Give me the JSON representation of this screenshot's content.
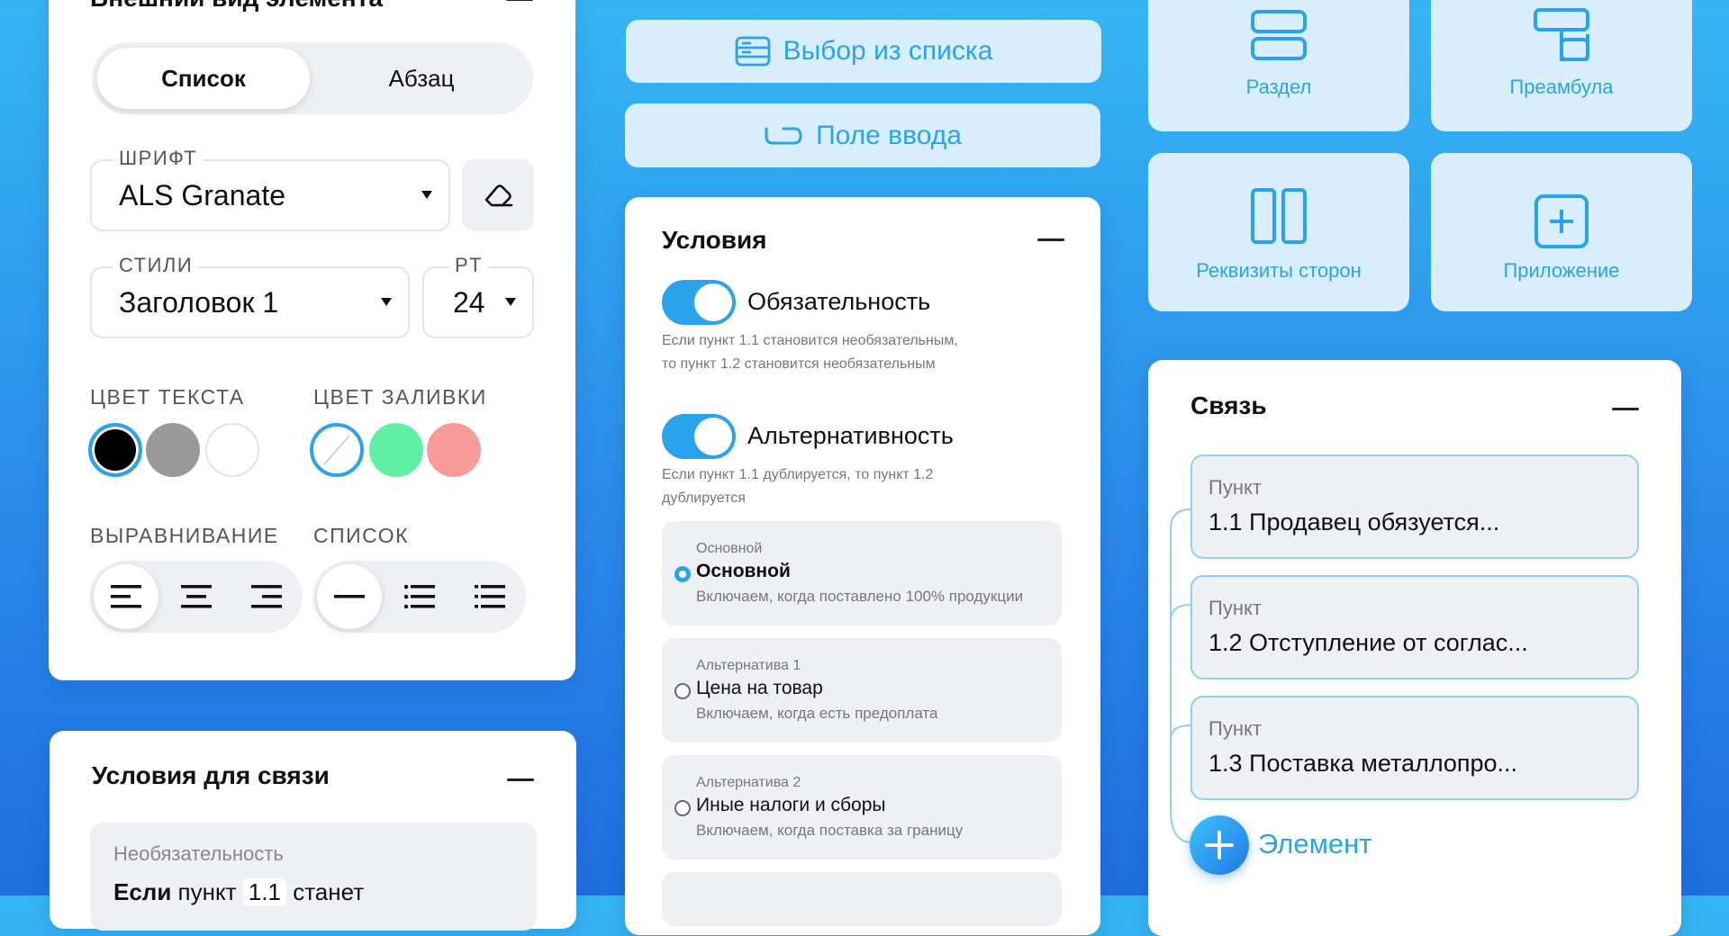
{
  "appearance": {
    "title": "Внешний вид элемента",
    "tabs": [
      {
        "label": "Список"
      },
      {
        "label": "Абзац"
      }
    ],
    "font": {
      "legend": "ШРИФТ",
      "value": "ALS Granate"
    },
    "style": {
      "legend": "СТИЛИ",
      "value": "Заголовок 1"
    },
    "size": {
      "legend": "PT",
      "value": "24"
    },
    "text_color_label": "ЦВЕТ ТЕКСТА",
    "fill_color_label": "ЦВЕТ ЗАЛИВКИ",
    "text_colors": [
      "#000000",
      "#999999",
      "#ffffff"
    ],
    "fill_colors": [
      "none",
      "#5ff0a6",
      "#f79b9b"
    ],
    "align_label": "ВЫРАВНИВАНИЕ",
    "list_label": "СПИСОК"
  },
  "link_conditions": {
    "title": "Условия для связи",
    "block_caption": "Необязательность",
    "block_text_bold": "Если",
    "block_text": "пункт",
    "block_ref": "1.1",
    "block_text_tail": "станет"
  },
  "buttons": {
    "select_list": "Выбор из списка",
    "input_field": "Поле ввода"
  },
  "conditions": {
    "title": "Условия",
    "toggles": [
      {
        "label": "Обязательность",
        "hint1": "Если пункт 1.1 становится необязательным,",
        "hint2": "то пункт 1.2 становится необязательным"
      },
      {
        "label": "Альтернативность",
        "hint1": "Если пункт 1.1 дублируется, то пункт 1.2",
        "hint2": "дублируется"
      }
    ],
    "options": [
      {
        "caption": "Основной",
        "name": "Основной",
        "desc": "Включаем, когда поставлено 100% продукции"
      },
      {
        "caption": "Альтернатива 1",
        "name": "Цена на товар",
        "desc": "Включаем, когда есть предоплата"
      },
      {
        "caption": "Альтернатива 2",
        "name": "Иные налоги и сборы",
        "desc": "Включаем, когда поставка за границу"
      }
    ]
  },
  "tiles": [
    {
      "label": "Раздел",
      "icon": "section-icon"
    },
    {
      "label": "Преамбула",
      "icon": "preamble-icon"
    },
    {
      "label": "Реквизиты сторон",
      "icon": "party-details-icon"
    },
    {
      "label": "Приложение",
      "icon": "appendix-icon"
    }
  ],
  "link": {
    "title": "Связь",
    "items": [
      {
        "caption": "Пункт",
        "text": "1.1  Продавец обязуется..."
      },
      {
        "caption": "Пункт",
        "text": "1.2  Отступление от соглас..."
      },
      {
        "caption": "Пункт",
        "text": "1.3  Поставка металлопро..."
      }
    ],
    "add_label": "Элемент"
  },
  "colors": {
    "accent": "#2aa3ec",
    "light": "#d8eefc"
  }
}
